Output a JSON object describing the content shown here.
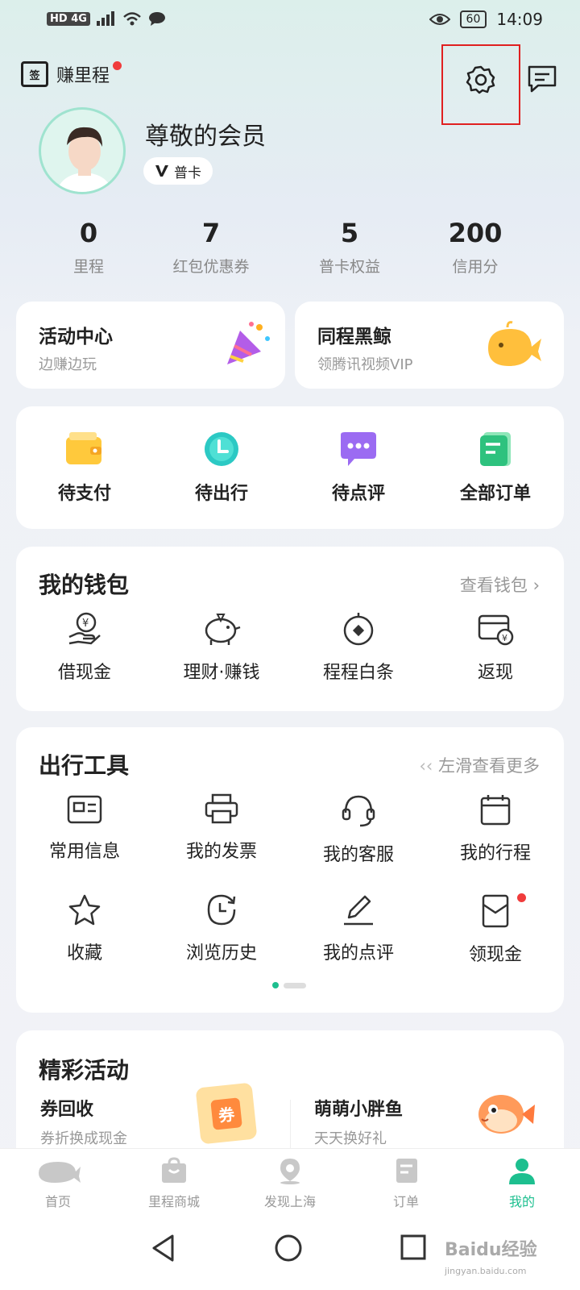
{
  "status_bar": {
    "left_icons": "HD 4G",
    "battery": "60",
    "time": "14:09"
  },
  "header": {
    "earn_label": "赚里程",
    "calendar_glyph": "签"
  },
  "profile": {
    "name": "尊敬的会员",
    "card_label": "普卡"
  },
  "stats": [
    {
      "value": "0",
      "label": "里程"
    },
    {
      "value": "7",
      "label": "红包优惠券"
    },
    {
      "value": "5",
      "label": "普卡权益"
    },
    {
      "value": "200",
      "label": "信用分"
    }
  ],
  "promo": [
    {
      "title": "活动中心",
      "sub": "边赚边玩"
    },
    {
      "title": "同程黑鲸",
      "sub": "领腾讯视频VIP"
    }
  ],
  "orders": [
    {
      "label": "待支付"
    },
    {
      "label": "待出行"
    },
    {
      "label": "待点评"
    },
    {
      "label": "全部订单"
    }
  ],
  "wallet": {
    "title": "我的钱包",
    "more": "查看钱包",
    "items": [
      {
        "label": "借现金"
      },
      {
        "label": "理财·赚钱"
      },
      {
        "label": "程程白条"
      },
      {
        "label": "返现"
      }
    ]
  },
  "tools": {
    "title": "出行工具",
    "more": "左滑查看更多",
    "row1": [
      {
        "label": "常用信息"
      },
      {
        "label": "我的发票"
      },
      {
        "label": "我的客服"
      },
      {
        "label": "我的行程"
      }
    ],
    "row2": [
      {
        "label": "收藏"
      },
      {
        "label": "浏览历史"
      },
      {
        "label": "我的点评"
      },
      {
        "label": "领现金"
      }
    ]
  },
  "events": {
    "title": "精彩活动",
    "items": [
      {
        "title": "券回收",
        "sub": "券折换成现金",
        "badge": "券"
      },
      {
        "title": "萌萌小胖鱼",
        "sub": "天天换好礼"
      }
    ]
  },
  "tabbar": [
    {
      "label": "首页"
    },
    {
      "label": "里程商城"
    },
    {
      "label": "发现上海"
    },
    {
      "label": "订单"
    },
    {
      "label": "我的"
    }
  ],
  "colors": {
    "accent": "#1dbf8f",
    "red": "#e02020"
  },
  "watermark": {
    "brand": "Baidu经验",
    "url": "jingyan.baidu.com"
  }
}
